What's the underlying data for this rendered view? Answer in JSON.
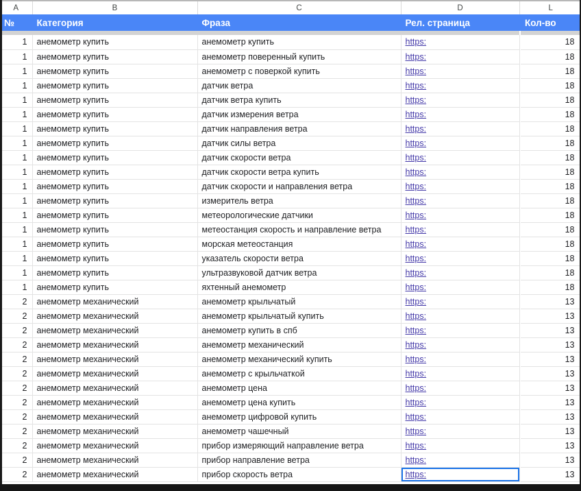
{
  "spreadsheet": {
    "column_letters": [
      "A",
      "B",
      "C",
      "D",
      "L"
    ],
    "headers": {
      "num": "№",
      "category": "Категория",
      "phrase": "Фраза",
      "page": "Рел. страница",
      "count": "Кол-во"
    },
    "colors": {
      "header_background": "#4a86f7",
      "header_text": "#ffffff",
      "link": "#4338a8",
      "grid_line": "#e3e3e3",
      "freeze_band": "#d3d3d3",
      "selection": "#1a73e8",
      "cell_text": "#202124"
    },
    "link_label": "https:",
    "rows": [
      {
        "num": "1",
        "category": "анемометр купить",
        "phrase": "анемометр купить",
        "page": "https:",
        "count": "18"
      },
      {
        "num": "1",
        "category": "анемометр купить",
        "phrase": "анемометр поверенный купить",
        "page": "https:",
        "count": "18"
      },
      {
        "num": "1",
        "category": "анемометр купить",
        "phrase": "анемометр с поверкой купить",
        "page": "https:",
        "count": "18"
      },
      {
        "num": "1",
        "category": "анемометр купить",
        "phrase": "датчик ветра",
        "page": "https:",
        "count": "18"
      },
      {
        "num": "1",
        "category": "анемометр купить",
        "phrase": "датчик ветра купить",
        "page": "https:",
        "count": "18"
      },
      {
        "num": "1",
        "category": "анемометр купить",
        "phrase": "датчик измерения ветра",
        "page": "https:",
        "count": "18"
      },
      {
        "num": "1",
        "category": "анемометр купить",
        "phrase": "датчик направления ветра",
        "page": "https:",
        "count": "18"
      },
      {
        "num": "1",
        "category": "анемометр купить",
        "phrase": "датчик силы ветра",
        "page": "https:",
        "count": "18"
      },
      {
        "num": "1",
        "category": "анемометр купить",
        "phrase": "датчик скорости ветра",
        "page": "https:",
        "count": "18"
      },
      {
        "num": "1",
        "category": "анемометр купить",
        "phrase": "датчик скорости ветра купить",
        "page": "https:",
        "count": "18"
      },
      {
        "num": "1",
        "category": "анемометр купить",
        "phrase": "датчик скорости и направления ветра",
        "page": "https:",
        "count": "18"
      },
      {
        "num": "1",
        "category": "анемометр купить",
        "phrase": "измеритель ветра",
        "page": "https:",
        "count": "18"
      },
      {
        "num": "1",
        "category": "анемометр купить",
        "phrase": "метеорологические датчики",
        "page": "https:",
        "count": "18"
      },
      {
        "num": "1",
        "category": "анемометр купить",
        "phrase": "метеостанция скорость и направление ветра",
        "page": "https:",
        "count": "18"
      },
      {
        "num": "1",
        "category": "анемометр купить",
        "phrase": "морская метеостанция",
        "page": "https:",
        "count": "18"
      },
      {
        "num": "1",
        "category": "анемометр купить",
        "phrase": "указатель скорости ветра",
        "page": "https:",
        "count": "18"
      },
      {
        "num": "1",
        "category": "анемометр купить",
        "phrase": "ультразвуковой датчик ветра",
        "page": "https:",
        "count": "18"
      },
      {
        "num": "1",
        "category": "анемометр купить",
        "phrase": "яхтенный анемометр",
        "page": "https:",
        "count": "18"
      },
      {
        "num": "2",
        "category": "анемометр механический",
        "phrase": "анемометр крыльчатый",
        "page": "https:",
        "count": "13"
      },
      {
        "num": "2",
        "category": "анемометр механический",
        "phrase": "анемометр крыльчатый купить",
        "page": "https:",
        "count": "13"
      },
      {
        "num": "2",
        "category": "анемометр механический",
        "phrase": "анемометр купить в спб",
        "page": "https:",
        "count": "13"
      },
      {
        "num": "2",
        "category": "анемометр механический",
        "phrase": "анемометр механический",
        "page": "https:",
        "count": "13"
      },
      {
        "num": "2",
        "category": "анемометр механический",
        "phrase": "анемометр механический купить",
        "page": "https:",
        "count": "13"
      },
      {
        "num": "2",
        "category": "анемометр механический",
        "phrase": "анемометр с крыльчаткой",
        "page": "https:",
        "count": "13"
      },
      {
        "num": "2",
        "category": "анемометр механический",
        "phrase": "анемометр цена",
        "page": "https:",
        "count": "13"
      },
      {
        "num": "2",
        "category": "анемометр механический",
        "phrase": "анемометр цена купить",
        "page": "https:",
        "count": "13"
      },
      {
        "num": "2",
        "category": "анемометр механический",
        "phrase": "анемометр цифровой купить",
        "page": "https:",
        "count": "13"
      },
      {
        "num": "2",
        "category": "анемометр механический",
        "phrase": "анемометр чашечный",
        "page": "https:",
        "count": "13"
      },
      {
        "num": "2",
        "category": "анемометр механический",
        "phrase": "прибор измеряющий направление ветра",
        "page": "https:",
        "count": "13"
      },
      {
        "num": "2",
        "category": "анемометр механический",
        "phrase": "прибор направление ветра",
        "page": "https:",
        "count": "13"
      },
      {
        "num": "2",
        "category": "анемометр механический",
        "phrase": "прибор скорость ветра",
        "page": "https:",
        "count": "13"
      }
    ]
  }
}
